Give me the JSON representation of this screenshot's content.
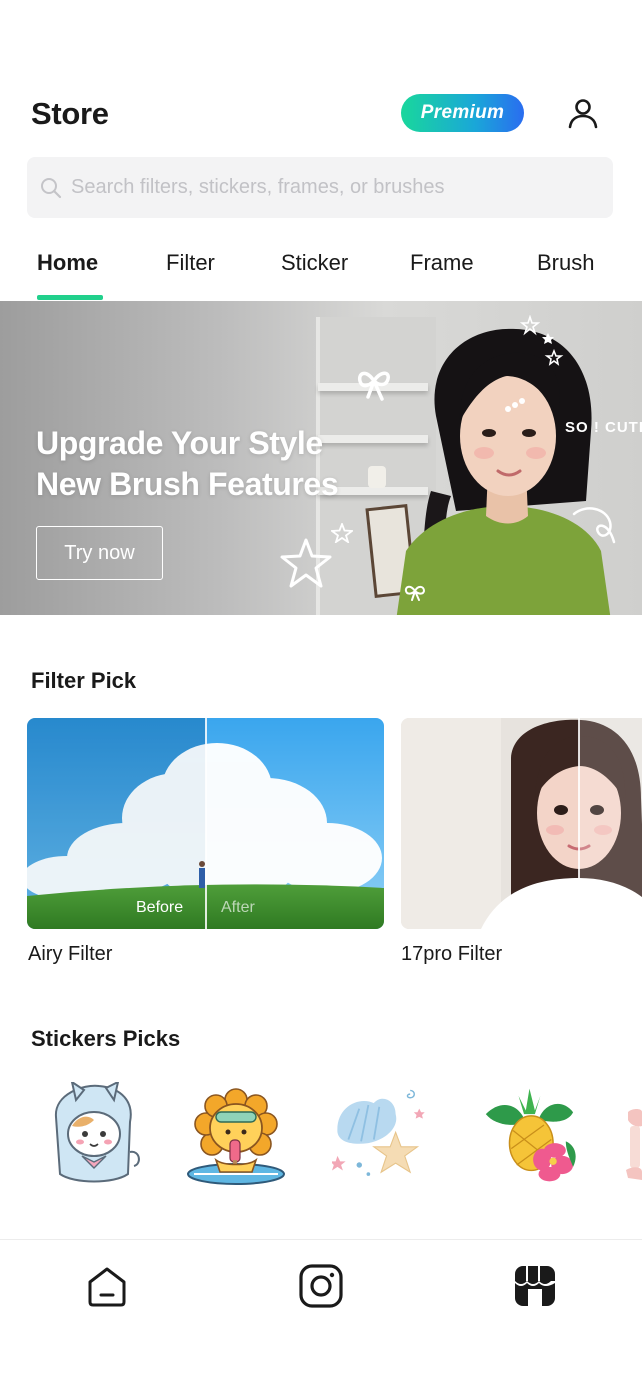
{
  "header": {
    "title": "Store",
    "premium_label": "Premium"
  },
  "search": {
    "placeholder": "Search filters, stickers, frames, or brushes"
  },
  "tabs": [
    {
      "label": "Home",
      "active": true
    },
    {
      "label": "Filter",
      "active": false
    },
    {
      "label": "Sticker",
      "active": false
    },
    {
      "label": "Frame",
      "active": false
    },
    {
      "label": "Brush",
      "active": false
    }
  ],
  "banner": {
    "line1": "Upgrade Your Style",
    "line2": "New Brush Features",
    "cta": "Try now",
    "sticker_text": "SO ! CUTE"
  },
  "filter_pick": {
    "title": "Filter Pick",
    "before_label": "Before",
    "after_label": "After",
    "items": [
      {
        "name": "Airy Filter"
      },
      {
        "name": "17pro Filter"
      }
    ]
  },
  "stickers_picks": {
    "title": "Stickers Picks",
    "items": [
      "cat-raincoat-sticker",
      "lion-surfboard-sticker",
      "seashell-starfish-sticker",
      "pineapple-hibiscus-sticker",
      "partial-sticker"
    ]
  },
  "bottom_nav": {
    "items": [
      "home-icon",
      "instagram-icon",
      "store-icon"
    ]
  },
  "colors": {
    "accent": "#21d08c",
    "premium_gradient_start": "#19d79c",
    "premium_gradient_end": "#2a6df0"
  }
}
